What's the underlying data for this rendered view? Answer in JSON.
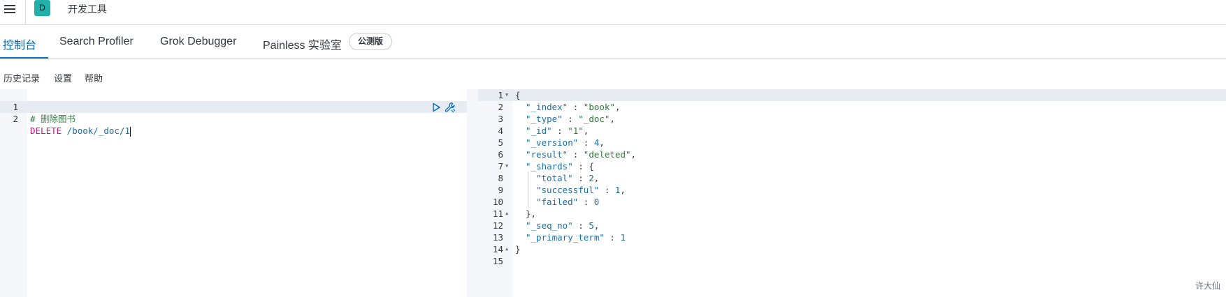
{
  "header": {
    "space_initial": "D",
    "app_title": "开发工具",
    "icons": {
      "menu": "hamburger-menu-icon"
    }
  },
  "tabs": [
    {
      "label": "控制台",
      "active": true
    },
    {
      "label": "Search Profiler",
      "active": false
    },
    {
      "label": "Grok Debugger",
      "active": false
    },
    {
      "label": "Painless 实验室",
      "active": false
    }
  ],
  "beta_badge": "公测版",
  "toolbar": {
    "history": "历史记录",
    "settings": "设置",
    "help": "帮助"
  },
  "input_editor": {
    "line_numbers": [
      "1",
      "2"
    ],
    "comment": "# 删除图书",
    "method": "DELETE",
    "url": " /book/_doc/1",
    "icons": {
      "run": "play-icon",
      "options": "wrench-icon"
    }
  },
  "output_editor": {
    "line_numbers": [
      "1",
      "2",
      "3",
      "4",
      "5",
      "6",
      "7",
      "8",
      "9",
      "10",
      "11",
      "12",
      "13",
      "14",
      "15"
    ],
    "lines": [
      {
        "key": "",
        "value": "",
        "open": "{"
      },
      {
        "key": "\"_index\"",
        "value": "\"book\"",
        "suffix": ","
      },
      {
        "key": "\"_type\"",
        "value": "\"_doc\"",
        "suffix": ","
      },
      {
        "key": "\"_id\"",
        "value": "\"1\"",
        "suffix": ","
      },
      {
        "key": "\"_version\"",
        "value": "4",
        "suffix": ","
      },
      {
        "key": "\"result\"",
        "value": "\"deleted\"",
        "suffix": ","
      },
      {
        "key": "\"_shards\"",
        "value": "{",
        "suffix": ""
      },
      {
        "key": "\"total\"",
        "value": "2",
        "suffix": ","
      },
      {
        "key": "\"successful\"",
        "value": "1",
        "suffix": ","
      },
      {
        "key": "\"failed\"",
        "value": "0",
        "suffix": ""
      },
      {
        "key": "",
        "value": "",
        "open": "},"
      },
      {
        "key": "\"_seq_no\"",
        "value": "5",
        "suffix": ","
      },
      {
        "key": "\"_primary_term\"",
        "value": "1",
        "suffix": ""
      },
      {
        "key": "",
        "value": "",
        "open": "}"
      },
      {
        "key": "",
        "value": "",
        "open": ""
      }
    ]
  },
  "watermark": "许大仙",
  "colors": {
    "accent": "#006bb8",
    "avatar_bg": "#20b2aa",
    "method": "#c71585",
    "string": "#2e7d32",
    "key": "#1a6fa8"
  }
}
